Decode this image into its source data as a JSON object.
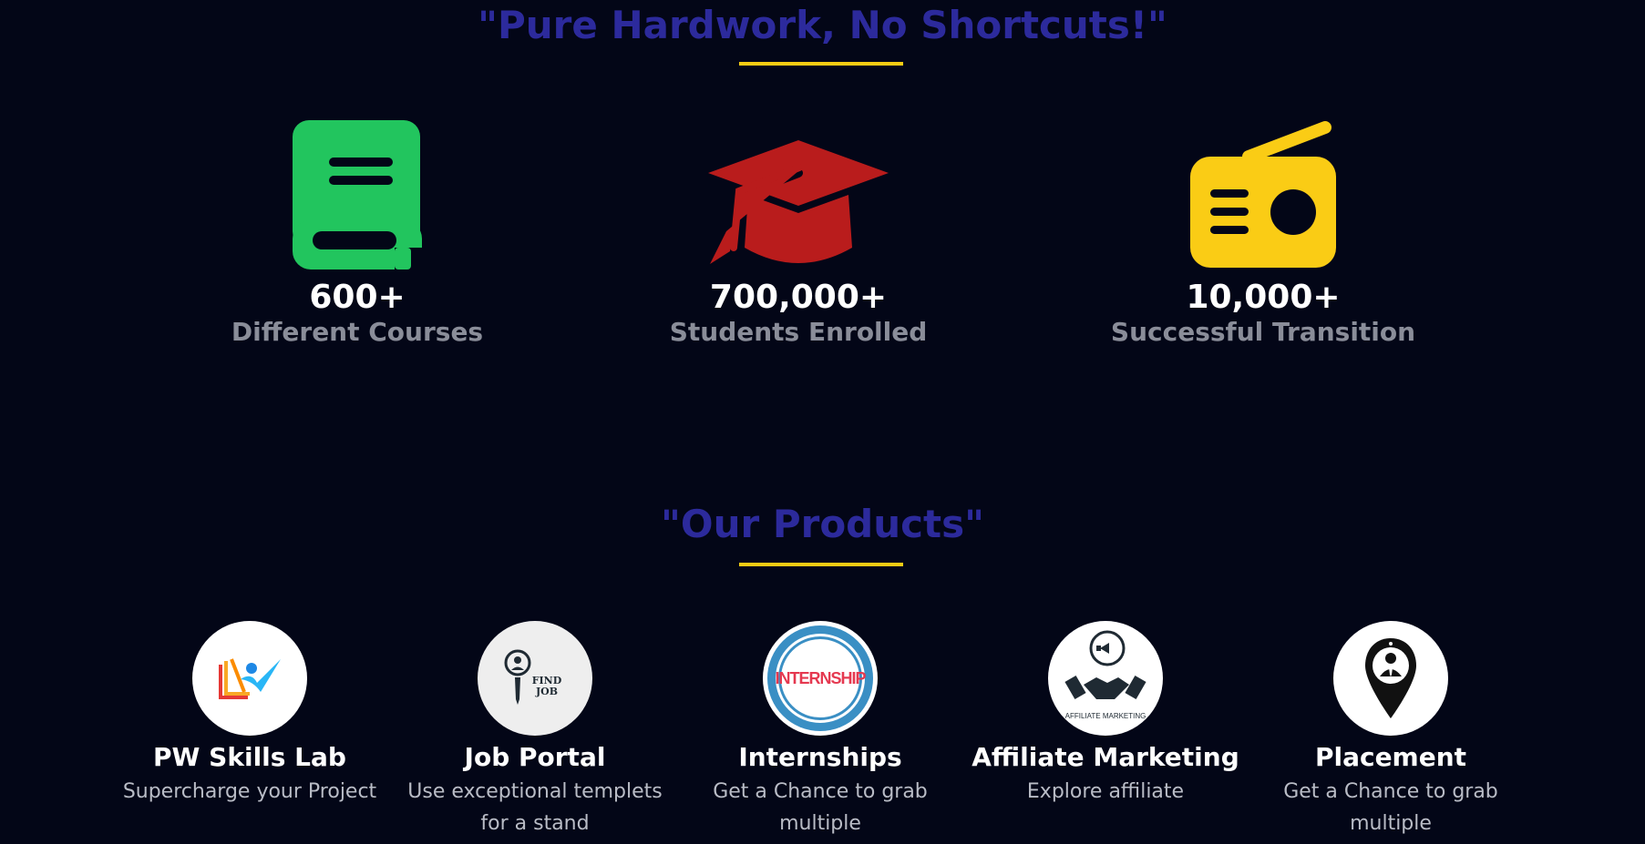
{
  "stats_section": {
    "heading": "\"Pure Hardwork, No Shortcuts!\"",
    "items": [
      {
        "icon": "book-icon",
        "value": "600+",
        "label": "Different Courses",
        "color": "#22c55e"
      },
      {
        "icon": "graduation-cap-icon",
        "value": "700,000+",
        "label": "Students Enrolled",
        "color": "#b91c1c"
      },
      {
        "icon": "radio-icon",
        "value": "10,000+",
        "label": "Successful Transition",
        "color": "#facc15"
      }
    ]
  },
  "products_section": {
    "heading": "\"Our Products\"",
    "items": [
      {
        "icon": "pw-skills-lab-logo",
        "title": "PW Skills Lab",
        "desc": "Supercharge your Project"
      },
      {
        "icon": "find-job-logo",
        "logo_text": "FIND JOB",
        "title": "Job Portal",
        "desc": "Use exceptional templets for a stand"
      },
      {
        "icon": "internship-badge-logo",
        "logo_text": "INTERNSHIP",
        "title": "Internships",
        "desc": "Get a Chance to grab multiple"
      },
      {
        "icon": "affiliate-marketing-logo",
        "logo_text": "AFFILIATE MARKETING",
        "title": "Affiliate Marketing",
        "desc": "Explore affiliate"
      },
      {
        "icon": "placement-pin-logo",
        "title": "Placement",
        "desc": "Get a Chance to grab multiple"
      }
    ]
  },
  "colors": {
    "background": "#030617",
    "heading": "#2c2a9c",
    "accent": "#f8cb13"
  }
}
